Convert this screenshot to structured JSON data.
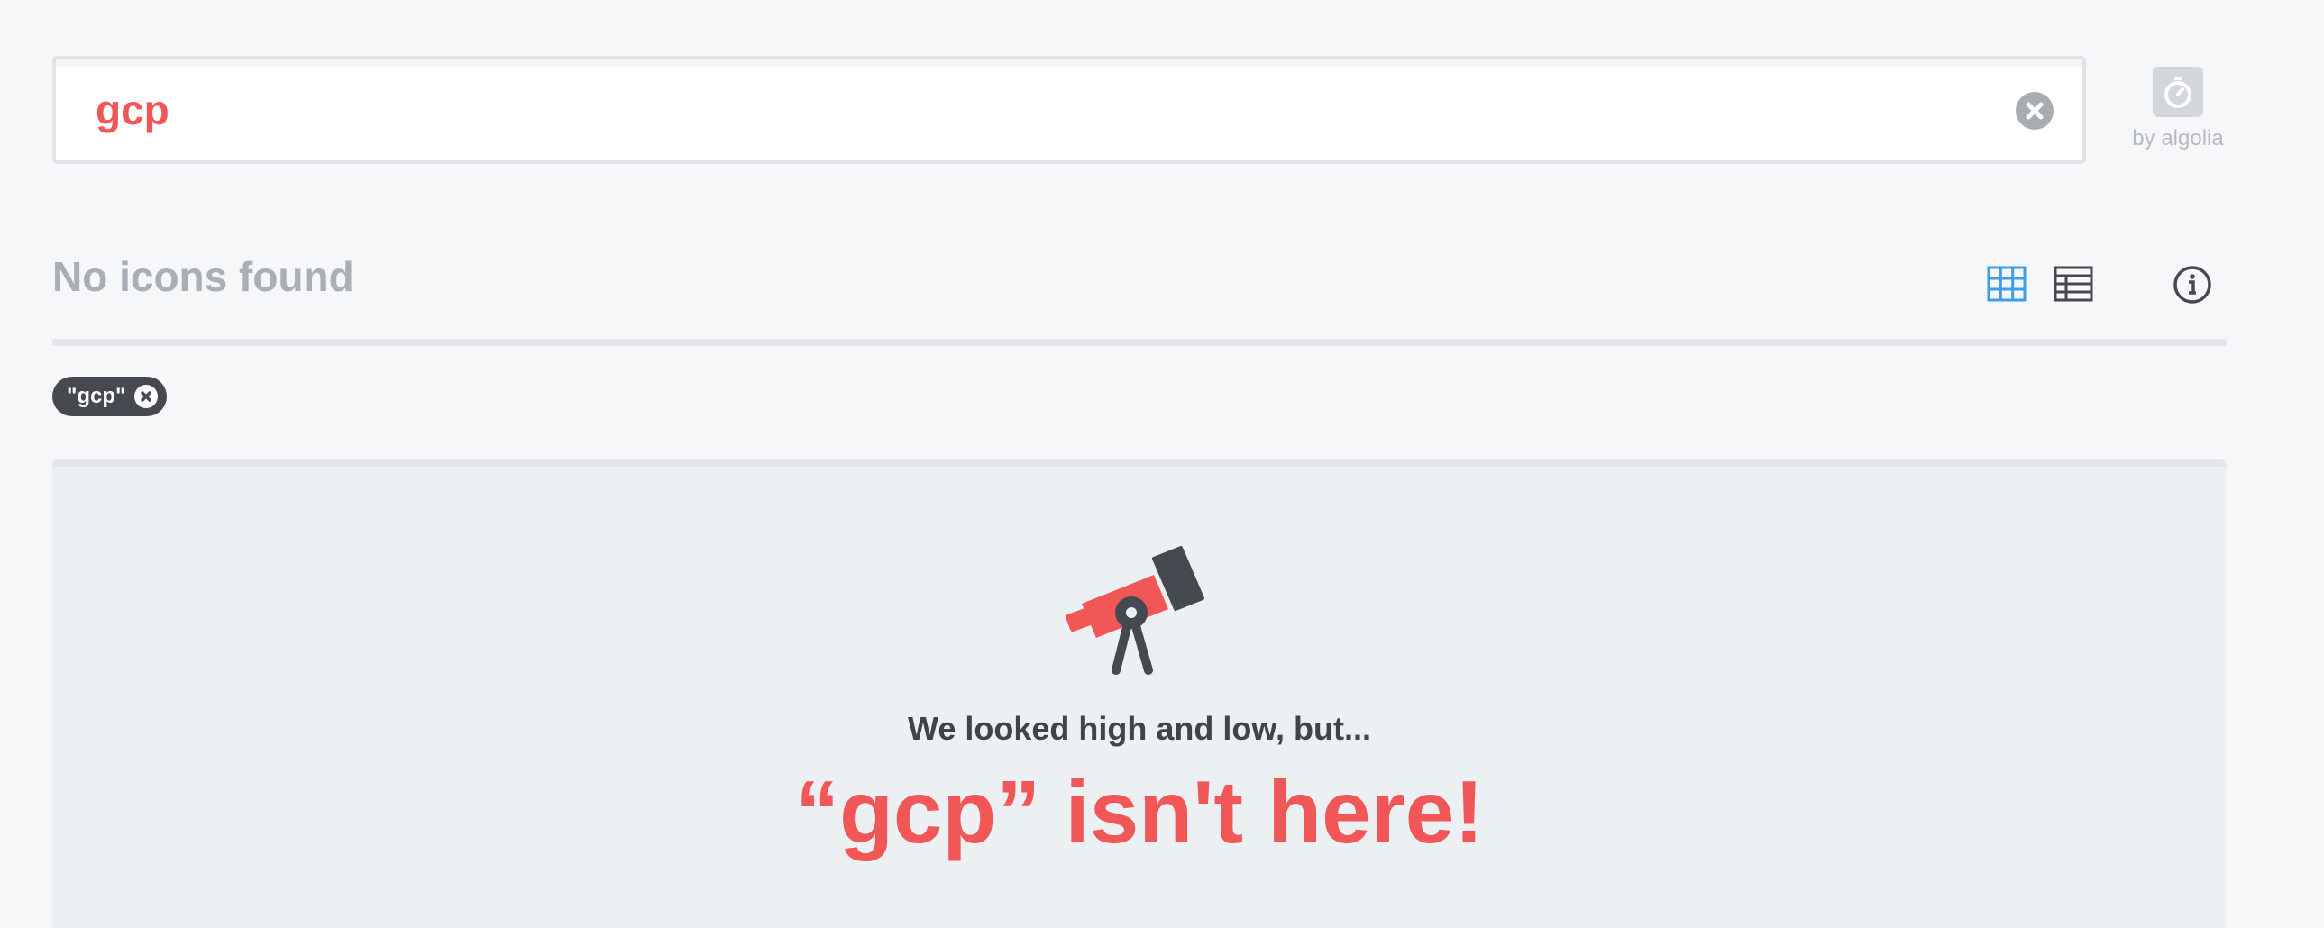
{
  "search": {
    "value": "gcp",
    "placeholder": ""
  },
  "algolia": {
    "icon": "stopwatch-icon",
    "label": "by algolia"
  },
  "results": {
    "title": "No icons found",
    "view_grid_icon": "grid-view-icon",
    "view_table_icon": "table-view-icon",
    "info_icon": "info-icon"
  },
  "filters": [
    {
      "label": "\"gcp\""
    }
  ],
  "empty_state": {
    "icon": "telescope-icon",
    "subtitle": "We looked high and low, but...",
    "headline": "“gcp” isn't here!"
  },
  "colors": {
    "accent": "#f25757",
    "grid_active": "#3e9ee6",
    "dark": "#464a50",
    "muted": "#a9afb6",
    "panel": "#edf0f3"
  }
}
